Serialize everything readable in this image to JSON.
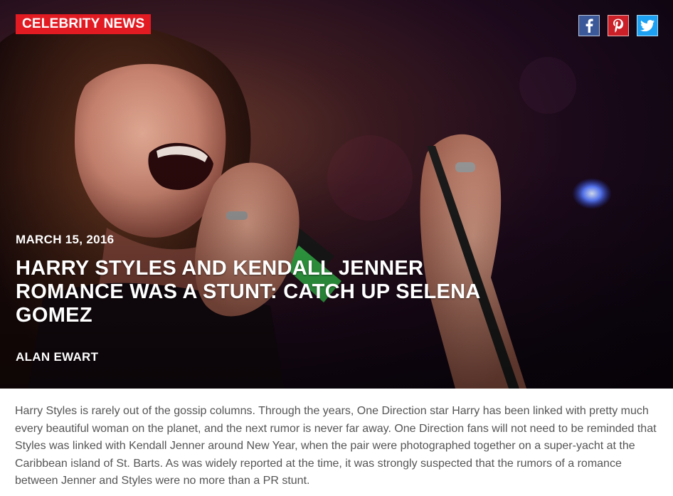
{
  "article": {
    "category": "CELEBRITY NEWS",
    "date": "MARCH 15, 2016",
    "headline": "HARRY STYLES AND KENDALL JENNER ROMANCE WAS A STUNT: CATCH UP SELENA GOMEZ",
    "author": "ALAN EWART",
    "body": "Harry Styles is rarely out of the gossip columns. Through the years, One Direction star Harry has been linked with pretty much every beautiful woman on the planet, and the next rumor is never far away. One Direction fans will not need to be reminded that Styles was linked with Kendall Jenner around New Year, when the pair were photographed together on a super-yacht at the Caribbean island of St. Barts. As was widely reported at the time, it was strongly suspected that the rumors of a romance between Jenner and Styles were no more than a PR stunt."
  },
  "social": {
    "items": [
      {
        "icon": "facebook-icon",
        "color": "#3b5998"
      },
      {
        "icon": "pinterest-icon",
        "color": "#cb2027"
      },
      {
        "icon": "twitter-icon",
        "color": "#1da1f2"
      }
    ]
  },
  "colors": {
    "badge": "#e21b23",
    "text": "#555555"
  }
}
